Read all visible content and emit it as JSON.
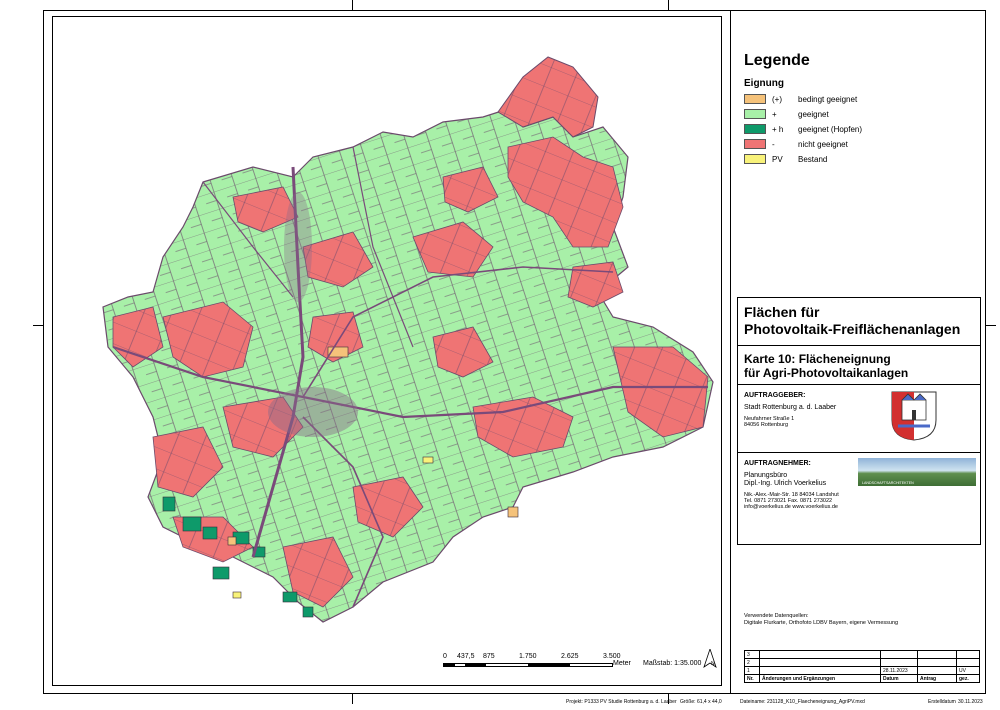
{
  "legend": {
    "title": "Legende",
    "subtitle": "Eignung",
    "items": [
      {
        "code": "(+)",
        "label": "bedingt geeignet",
        "color": "#f5c27a"
      },
      {
        "code": "+",
        "label": "geeignet",
        "color": "#a8f0a8"
      },
      {
        "code": "+ h",
        "label": "geeignet (Hopfen)",
        "color": "#0e9a6a"
      },
      {
        "code": "-",
        "label": "nicht geeignet",
        "color": "#ef7474"
      },
      {
        "code": "PV",
        "label": "Bestand",
        "color": "#f8f27a"
      }
    ]
  },
  "title": {
    "line1": "Flächen für",
    "line2": "Photovoltaik-Freiflächenanlagen",
    "map_line1": "Karte 10: Flächeneignung",
    "map_line2": "für Agri-Photovoltaikanlagen"
  },
  "client": {
    "heading": "AUFTRAGGEBER:",
    "name": "Stadt Rottenburg a. d. Laaber",
    "street": "Neufahrner Straße 1",
    "city": "84056 Rottenburg"
  },
  "contractor": {
    "heading": "AUFTRAGNEHMER:",
    "line1": "Planungsbüro",
    "line2": "Dipl.-Ing. Ulrich Voerkelius",
    "addr1": "Nik.-Alex.-Mair-Str. 18  84034 Landshut",
    "addr2": "Tel. 0871 273021  Fax. 0871 273022",
    "addr3": "info@voerkelius.de   www.voerkelius.de",
    "logo_text": "LANDSCHAFTSARCHITEKTEN"
  },
  "sources": {
    "label": "Verwendete Datenquellen:",
    "text": "Digitale Flurkarte,  Orthofoto LDBV Bayern, eigene Vermessung"
  },
  "revisions": {
    "row_numbers": [
      "3",
      "2",
      "1"
    ],
    "date1": "28.11.2023",
    "initials1": "UV",
    "headers": [
      "Nr.",
      "Änderungen und Ergänzungen",
      "Datum",
      "Antrag",
      "gez."
    ]
  },
  "scalebar": {
    "ticks": [
      "0",
      "437,5",
      "875",
      "1.750",
      "2.625",
      "3.500"
    ],
    "unit": "Meter",
    "scale": "Maßstab: 1:35.000",
    "north": "N"
  },
  "footer": {
    "project": "Projekt: P1333 PV Studie Rottenburg a. d. Laaber",
    "size": "Größe: 61,4 x 44,0",
    "file": "Dateiname: 231128_K10_Flaecheneignung_AgriPV.mxd",
    "created_label": "Erstelldatum",
    "created": "30.11.2023"
  },
  "map_colors": {
    "green": "#a8f0a8",
    "red": "#ef7474",
    "dark_green": "#0e9a6a",
    "road": "#7a4a7a"
  }
}
